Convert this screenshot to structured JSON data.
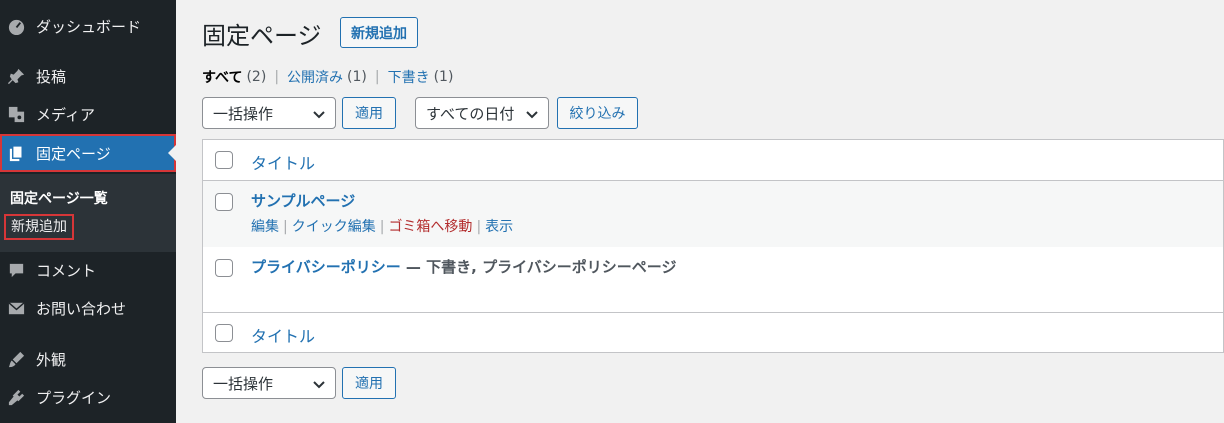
{
  "sidebar": {
    "items": [
      {
        "label": "ダッシュボード",
        "icon": "dashboard-icon"
      },
      {
        "label": "投稿",
        "icon": "pin-icon"
      },
      {
        "label": "メディア",
        "icon": "media-icon"
      },
      {
        "label": "固定ページ",
        "icon": "page-icon"
      },
      {
        "label": "コメント",
        "icon": "comment-icon"
      },
      {
        "label": "お問い合わせ",
        "icon": "mail-icon"
      },
      {
        "label": "外観",
        "icon": "brush-icon"
      },
      {
        "label": "プラグイン",
        "icon": "plugin-icon"
      }
    ],
    "submenu": {
      "title": "固定ページ一覧",
      "add_new": "新規追加"
    }
  },
  "header": {
    "title": "固定ページ",
    "add_new": "新規追加"
  },
  "filters": {
    "all": {
      "label": "すべて",
      "count": "(2)"
    },
    "published": {
      "label": "公開済み",
      "count": "(1)"
    },
    "draft": {
      "label": "下書き",
      "count": "(1)"
    },
    "sep": "|"
  },
  "toolbar": {
    "bulk_action": "一括操作",
    "apply": "適用",
    "date_filter": "すべての日付",
    "filter_button": "絞り込み"
  },
  "table": {
    "column_title": "タイトル",
    "rows": [
      {
        "title": "サンプルページ",
        "actions": {
          "edit": "編集",
          "quick_edit": "クイック編集",
          "trash": "ゴミ箱へ移動",
          "view": "表示",
          "sep": "|"
        }
      },
      {
        "title": "プライバシーポリシー",
        "state": " — 下書き, プライバシーポリシーページ"
      }
    ],
    "footer_title": "タイトル"
  },
  "bottom_toolbar": {
    "bulk_action": "一括操作",
    "apply": "適用"
  },
  "colors": {
    "sidebar_bg": "#1d2327",
    "accent": "#2271b1",
    "highlight": "#d63638",
    "trash": "#b32d2e"
  }
}
